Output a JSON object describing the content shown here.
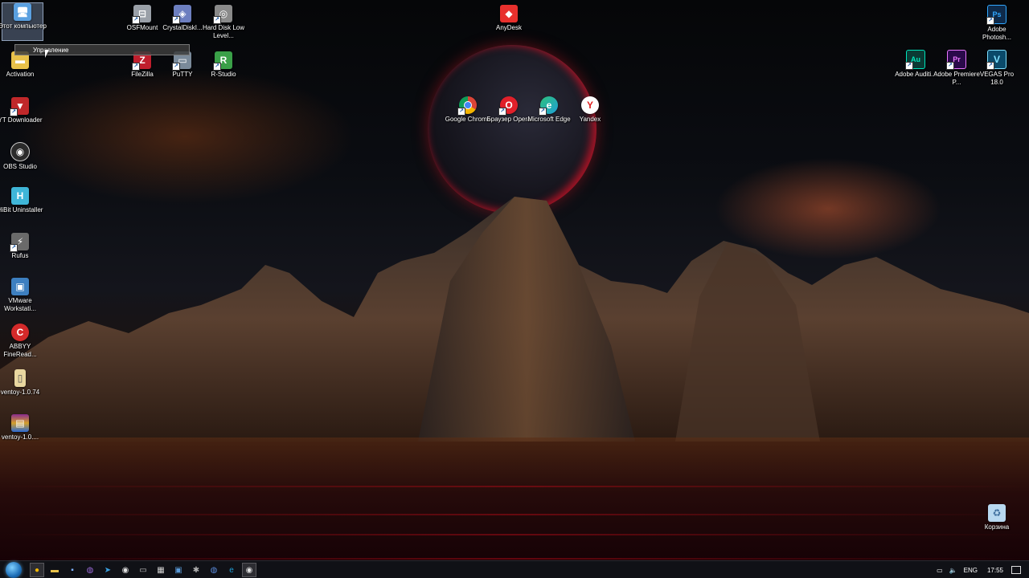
{
  "desktop_icons": [
    {
      "id": "this-pc",
      "label": "Этот компьютер",
      "icon": "computer-icon",
      "color": "#5aa0e0",
      "glyph": "🖥"
    },
    {
      "id": "activation",
      "label": "Activation",
      "icon": "folder-icon",
      "color": "#e8c14a",
      "glyph": "📁"
    },
    {
      "id": "yt-downloader",
      "label": "YT Downloader",
      "icon": "yt-downloader-icon",
      "color": "#c0282a",
      "glyph": "▼"
    },
    {
      "id": "obs-studio",
      "label": "OBS Studio",
      "icon": "obs-icon",
      "color": "#2b2b2b",
      "glyph": "◉"
    },
    {
      "id": "hibit",
      "label": "HiBit Uninstaller",
      "icon": "hibit-icon",
      "color": "#3fb6d8",
      "glyph": "H"
    },
    {
      "id": "rufus",
      "label": "Rufus",
      "icon": "rufus-icon",
      "color": "#6a6a6a",
      "glyph": "⚡"
    },
    {
      "id": "vmware",
      "label": "VMware Workstati...",
      "icon": "vmware-icon",
      "color": "#3d7fc0",
      "glyph": "▣"
    },
    {
      "id": "abbyy",
      "label": "ABBYY FineRead...",
      "icon": "abbyy-icon",
      "color": "#d42a2a",
      "glyph": "C"
    },
    {
      "id": "ventoy-folder",
      "label": "ventoy-1.0.74",
      "icon": "file-icon",
      "color": "#e9d7a0",
      "glyph": "▯"
    },
    {
      "id": "ventoy-archive",
      "label": "ventoy-1.0....",
      "icon": "winrar-icon",
      "color": "#8a2b8f",
      "glyph": "▤"
    },
    {
      "id": "osfmount",
      "label": "OSFMount",
      "icon": "osfmount-icon",
      "color": "#9aa0a8",
      "glyph": "⊟"
    },
    {
      "id": "crystaldisk",
      "label": "CrystalDiskI...",
      "icon": "crystaldisk-icon",
      "color": "#6d7fc0",
      "glyph": "◈"
    },
    {
      "id": "hdd-llf",
      "label": "Hard Disk Low Level...",
      "icon": "hdd-icon",
      "color": "#8a8a8a",
      "glyph": "◎"
    },
    {
      "id": "filezilla",
      "label": "FileZilla",
      "icon": "filezilla-icon",
      "color": "#bf1e2d",
      "glyph": "Z"
    },
    {
      "id": "putty",
      "label": "PuTTY",
      "icon": "putty-icon",
      "color": "#7a8a9a",
      "glyph": "▭"
    },
    {
      "id": "r-studio",
      "label": "R-Studio",
      "icon": "r-studio-icon",
      "color": "#3aa048",
      "glyph": "R"
    },
    {
      "id": "anydesk",
      "label": "AnyDesk",
      "icon": "anydesk-icon",
      "color": "#e8302d",
      "glyph": "◆"
    },
    {
      "id": "chrome",
      "label": "Google Chrome",
      "icon": "chrome-icon",
      "color": "#f2b705",
      "glyph": "●"
    },
    {
      "id": "opera",
      "label": "Браузер Opera",
      "icon": "opera-icon",
      "color": "#e0202a",
      "glyph": "O"
    },
    {
      "id": "edge",
      "label": "Microsoft Edge",
      "icon": "edge-icon",
      "color": "#1fa0d8",
      "glyph": "e"
    },
    {
      "id": "yandex",
      "label": "Yandex",
      "icon": "yandex-icon",
      "color": "#ffffff",
      "glyph": "Y"
    },
    {
      "id": "photoshop",
      "label": "Adobe Photosh...",
      "icon": "photoshop-icon",
      "color": "#0e2a4a",
      "glyph": "Ps"
    },
    {
      "id": "audition",
      "label": "Adobe Auditi...",
      "icon": "audition-icon",
      "color": "#0b3a34",
      "glyph": "Au"
    },
    {
      "id": "premiere",
      "label": "Adobe Premiere P...",
      "icon": "premiere-icon",
      "color": "#2a0a4a",
      "glyph": "Pr"
    },
    {
      "id": "vegas",
      "label": "VEGAS Pro 18.0",
      "icon": "vegas-icon",
      "color": "#0a4a6a",
      "glyph": "V"
    },
    {
      "id": "recycle",
      "label": "Корзина",
      "icon": "recycle-bin-icon",
      "color": "#b8d8f0",
      "glyph": "🗑"
    }
  ],
  "tooltip": {
    "text": "Управление"
  },
  "taskbar": {
    "apps": [
      {
        "name": "chrome-taskbar",
        "icon": "chrome-icon",
        "glyph": "●",
        "color": "#f2b705",
        "active": true
      },
      {
        "name": "explorer-taskbar",
        "icon": "folder-icon",
        "glyph": "▬",
        "color": "#e8c14a"
      },
      {
        "name": "save-taskbar",
        "icon": "disk-icon",
        "glyph": "▪",
        "color": "#7fb2ff"
      },
      {
        "name": "viber-taskbar",
        "icon": "viber-icon",
        "glyph": "◍",
        "color": "#9a6ad8"
      },
      {
        "name": "telegram-taskbar",
        "icon": "telegram-icon",
        "glyph": "➤",
        "color": "#3aa0e0"
      },
      {
        "name": "sync-taskbar",
        "icon": "sync-icon",
        "glyph": "◉",
        "color": "#e0e0e0"
      },
      {
        "name": "cmd-taskbar",
        "icon": "console-icon",
        "glyph": "▭",
        "color": "#c0c0c0"
      },
      {
        "name": "calc-taskbar",
        "icon": "calculator-icon",
        "glyph": "▦",
        "color": "#d0d0d0"
      },
      {
        "name": "remote-taskbar",
        "icon": "remote-desktop-icon",
        "glyph": "▣",
        "color": "#5a9ad8"
      },
      {
        "name": "settings-taskbar",
        "icon": "gear-icon",
        "glyph": "✱",
        "color": "#b0b0b0"
      },
      {
        "name": "globe-taskbar",
        "icon": "globe-icon",
        "glyph": "◍",
        "color": "#5a8ad8"
      },
      {
        "name": "edge-taskbar",
        "icon": "edge-icon",
        "glyph": "e",
        "color": "#1fa0d8"
      },
      {
        "name": "obs-taskbar",
        "icon": "obs-icon",
        "glyph": "◉",
        "color": "#e0e0e0",
        "active": true
      }
    ],
    "tray": {
      "lang": "ENG",
      "time": "17:55"
    }
  }
}
